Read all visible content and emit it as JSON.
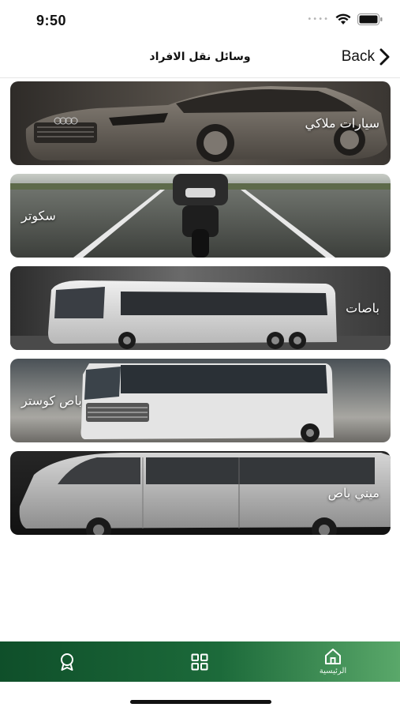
{
  "status_bar": {
    "time": "9:50",
    "icons": [
      "signal-dots-icon",
      "wifi-icon",
      "battery-icon"
    ]
  },
  "nav": {
    "title": "وسائل نقل الافراد",
    "back_label": "Back",
    "back_icon": "chevron-right-icon"
  },
  "cards": [
    {
      "label": "سيارات ملاكي",
      "image": "luxury-sedan-photo"
    },
    {
      "label": "سكوتر",
      "image": "motorcycle-road-photo"
    },
    {
      "label": "باصات",
      "image": "coach-bus-photo"
    },
    {
      "label": "باص كوستر",
      "image": "coaster-minibus-photo"
    },
    {
      "label": "ميني باص",
      "image": "van-photo"
    }
  ],
  "tab_bar": {
    "tabs": [
      {
        "icon": "award-icon",
        "label": ""
      },
      {
        "icon": "grid-icon",
        "label": ""
      },
      {
        "icon": "home-icon",
        "label": "الرئيسية"
      }
    ]
  },
  "colors": {
    "tab_bar_start": "#0f4f2a",
    "tab_bar_end": "#5aa86a",
    "card_text": "#ffffff"
  }
}
